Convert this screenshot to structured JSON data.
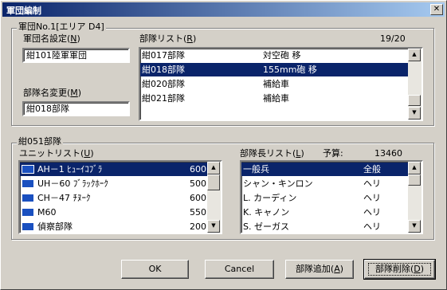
{
  "window": {
    "title": "軍団編制",
    "close": "✕"
  },
  "corps_group": {
    "legend": "軍団No.1[エリア D4]"
  },
  "corps_name": {
    "label": "軍団名設定(",
    "accel": "N",
    "tail": ")",
    "value": "紺101陸軍軍団"
  },
  "unit_rename": {
    "label": "部隊名変更(",
    "accel": "M",
    "tail": ")",
    "value": "紺018部隊"
  },
  "unit_list": {
    "label": "部隊リスト(",
    "accel": "R",
    "tail": ")",
    "count": "19/20",
    "rows": [
      {
        "name": "紺017部隊",
        "type": "対空砲 移",
        "selected": false
      },
      {
        "name": "紺018部隊",
        "type": "155mm砲 移",
        "selected": true
      },
      {
        "name": "紺020部隊",
        "type": "補給車",
        "selected": false
      },
      {
        "name": "紺021部隊",
        "type": "補給車",
        "selected": false
      }
    ]
  },
  "division_group": {
    "legend": "紺051部隊"
  },
  "unit_type_list": {
    "label": "ユニットリスト(",
    "accel": "U",
    "tail": ")",
    "rows": [
      {
        "icon": "helicopter-icon",
        "name": "AH－1 ﾋｭｰｲｺﾌﾞﾗ",
        "cost": "600",
        "selected": true
      },
      {
        "icon": "helicopter-icon",
        "name": "UH－60 ﾌﾞﾗｯｸﾎｰｸ",
        "cost": "500",
        "selected": false
      },
      {
        "icon": "helicopter-icon",
        "name": "CH－47 ﾁﾇｰｸ",
        "cost": "600",
        "selected": false
      },
      {
        "icon": "tank-icon",
        "name": "M60",
        "cost": "550",
        "selected": false
      },
      {
        "icon": "recon-icon",
        "name": "偵察部隊",
        "cost": "200",
        "selected": false
      }
    ]
  },
  "commander_list": {
    "label": "部隊長リスト(",
    "accel": "L",
    "tail": ")",
    "budget_label": "予算:",
    "budget_value": "13460",
    "rows": [
      {
        "name": "一般兵",
        "spec": "全般",
        "selected": true
      },
      {
        "name": "シャン・キンロン",
        "spec": "ヘリ",
        "selected": false
      },
      {
        "name": "L. カーディン",
        "spec": "ヘリ",
        "selected": false
      },
      {
        "name": "K. キャノン",
        "spec": "ヘリ",
        "selected": false
      },
      {
        "name": "S. ゼーガス",
        "spec": "ヘリ",
        "selected": false
      }
    ]
  },
  "buttons": {
    "ok": "OK",
    "cancel": "Cancel",
    "add": {
      "label": "部隊追加(",
      "accel": "A",
      "tail": ")"
    },
    "delete": {
      "label": "部隊削除(",
      "accel": "D",
      "tail": ")"
    }
  },
  "colors": {
    "selection": "#0a246a",
    "face": "#d4d0c8",
    "title_start": "#0a246a",
    "title_end": "#a6caf0"
  }
}
